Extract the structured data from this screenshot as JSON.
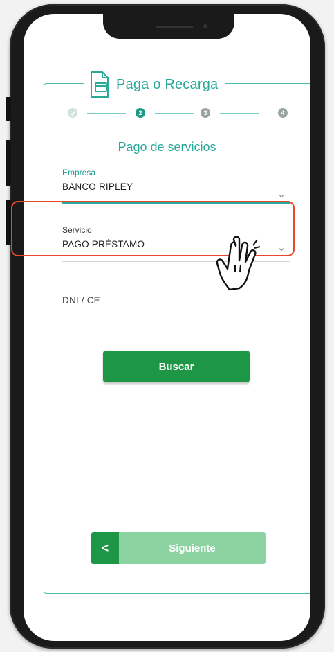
{
  "header": {
    "title": "Paga o Recarga"
  },
  "stepper": {
    "steps": [
      "",
      "2",
      "3",
      "4"
    ],
    "current": 2
  },
  "section_title": "Pago de servicios",
  "fields": {
    "empresa": {
      "label": "Empresa",
      "value": "BANCO RIPLEY"
    },
    "servicio": {
      "label": "Servicio",
      "value": "PAGO PRÉSTAMO"
    },
    "dni": {
      "placeholder": "DNI / CE"
    }
  },
  "buttons": {
    "buscar": "Buscar",
    "back": "<",
    "siguiente": "Siguiente"
  },
  "colors": {
    "teal": "#2aa899",
    "green": "#1d9745",
    "light_green": "#8dd3a1",
    "highlight": "#e8482a"
  },
  "icons": [
    "document-card-icon",
    "check-icon",
    "chevron-down-icon",
    "hand-pointer-icon",
    "chevron-left-icon"
  ]
}
